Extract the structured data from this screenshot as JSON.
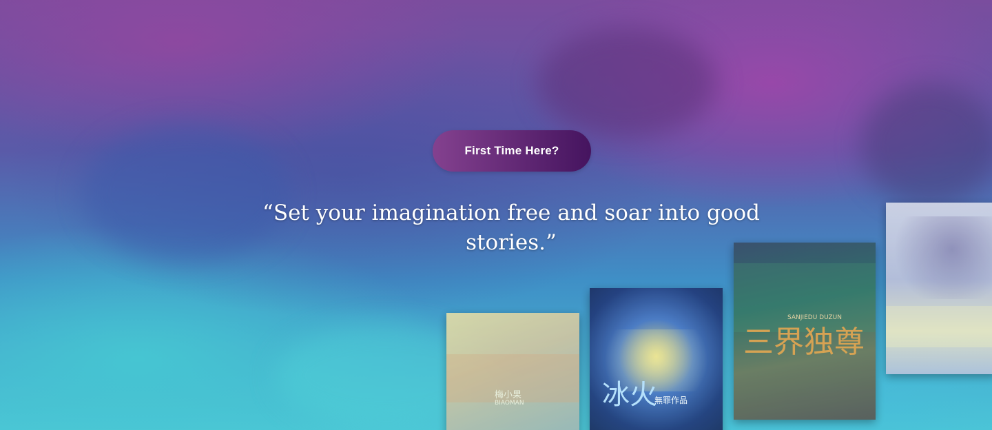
{
  "hero": {
    "cta_label": "First Time Here?",
    "quote": "“Set your imagination free and soar into good stories.”"
  },
  "covers": [
    {
      "name": "book-cover-1",
      "title_art": "梅小果",
      "art_sub": "BIAOMAN"
    },
    {
      "name": "book-cover-2",
      "title_art": "冰火",
      "art_sub": "無罪作品"
    },
    {
      "name": "book-cover-3",
      "title_art": "三界独尊",
      "art_sub": "SANJIEDU DUZUN"
    },
    {
      "name": "book-cover-4",
      "title_art": "",
      "art_sub": ""
    }
  ],
  "colors": {
    "cta_start": "#84418f",
    "cta_end": "#45145f",
    "quote_text": "#ffffff"
  }
}
